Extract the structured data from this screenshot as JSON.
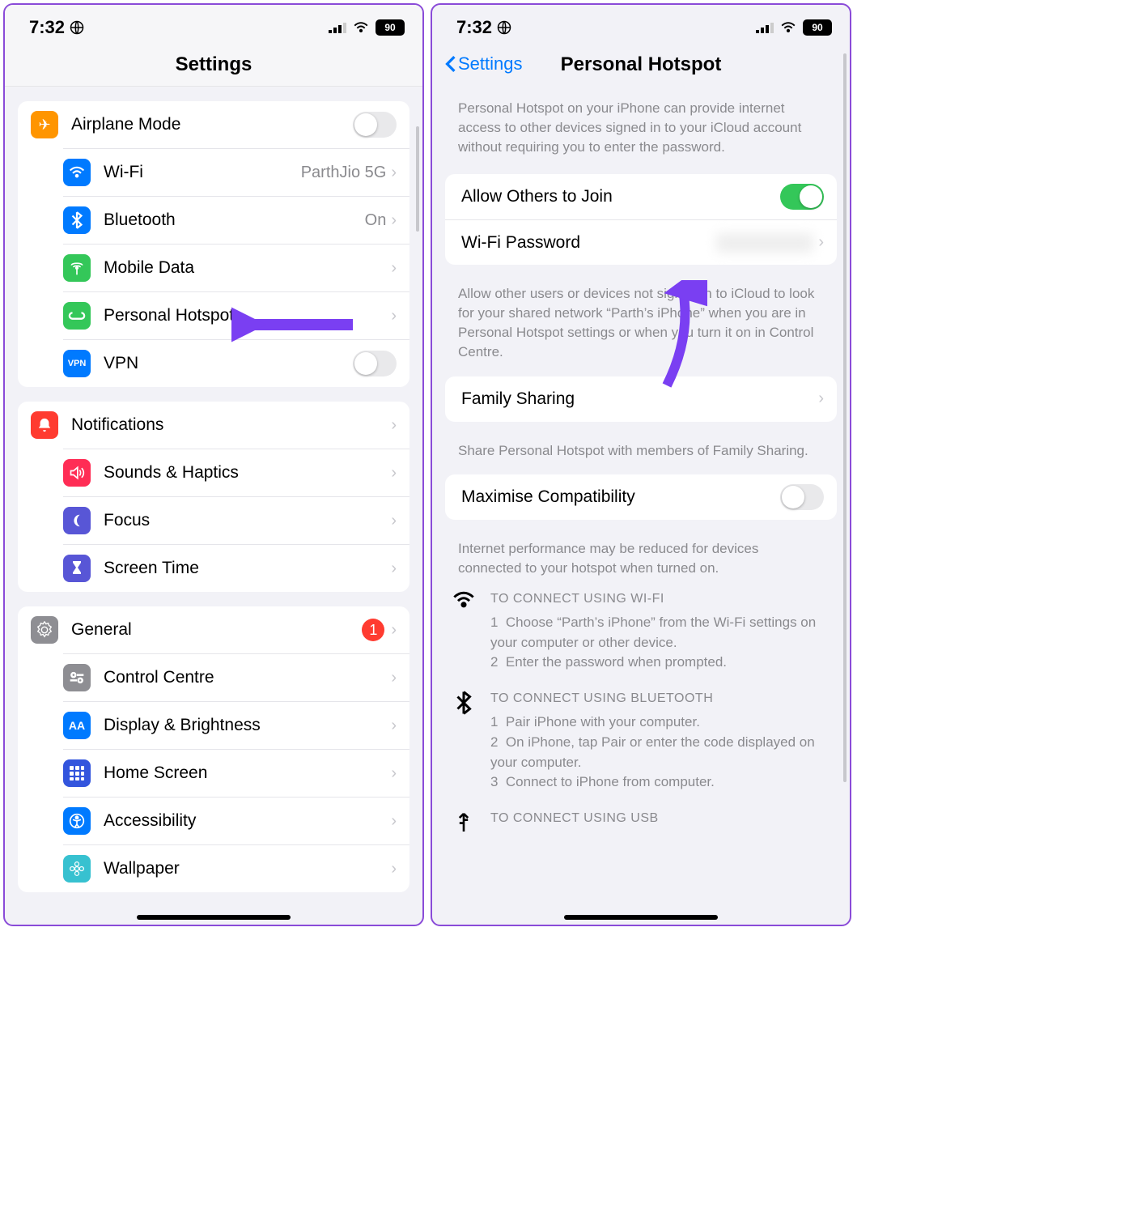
{
  "status": {
    "time": "7:32",
    "battery": "90"
  },
  "left": {
    "title": "Settings",
    "g1": [
      {
        "name": "airplane",
        "label": "Airplane Mode",
        "icon_bg": "#ff9500",
        "icon": "✈",
        "toggle": false
      },
      {
        "name": "wifi",
        "label": "Wi-Fi",
        "icon_bg": "#007aff",
        "icon": "wifi",
        "value": "ParthJio 5G",
        "chev": true
      },
      {
        "name": "bluetooth",
        "label": "Bluetooth",
        "icon_bg": "#007aff",
        "icon": "bt",
        "value": "On",
        "chev": true
      },
      {
        "name": "mobiledata",
        "label": "Mobile Data",
        "icon_bg": "#34c759",
        "icon": "ant",
        "chev": true
      },
      {
        "name": "hotspot",
        "label": "Personal Hotspot",
        "icon_bg": "#34c759",
        "icon": "link",
        "chev": true
      },
      {
        "name": "vpn",
        "label": "VPN",
        "icon_bg": "#007aff",
        "icon": "VPN",
        "toggle": false
      }
    ],
    "g2": [
      {
        "name": "notifications",
        "label": "Notifications",
        "icon_bg": "#ff3b30",
        "icon": "bell",
        "chev": true
      },
      {
        "name": "sounds",
        "label": "Sounds & Haptics",
        "icon_bg": "#ff2d55",
        "icon": "spk",
        "chev": true
      },
      {
        "name": "focus",
        "label": "Focus",
        "icon_bg": "#5856d6",
        "icon": "moon",
        "chev": true
      },
      {
        "name": "screentime",
        "label": "Screen Time",
        "icon_bg": "#5856d6",
        "icon": "hg",
        "chev": true
      }
    ],
    "g3": [
      {
        "name": "general",
        "label": "General",
        "icon_bg": "#8e8e93",
        "icon": "gear",
        "badge": "1",
        "chev": true
      },
      {
        "name": "controlcentre",
        "label": "Control Centre",
        "icon_bg": "#8e8e93",
        "icon": "cc",
        "chev": true
      },
      {
        "name": "display",
        "label": "Display & Brightness",
        "icon_bg": "#007aff",
        "icon": "AA",
        "chev": true
      },
      {
        "name": "homescreen",
        "label": "Home Screen",
        "icon_bg": "#3355dd",
        "icon": "grid",
        "chev": true
      },
      {
        "name": "accessibility",
        "label": "Accessibility",
        "icon_bg": "#007aff",
        "icon": "acc",
        "chev": true
      },
      {
        "name": "wallpaper",
        "label": "Wallpaper",
        "icon_bg": "#37c1d0",
        "icon": "flw",
        "chev": true
      }
    ]
  },
  "right": {
    "back": "Settings",
    "title": "Personal Hotspot",
    "intro": "Personal Hotspot on your iPhone can provide internet access to other devices signed in to your iCloud account without requiring you to enter the password.",
    "allow_label": "Allow Others to Join",
    "wifi_pw_label": "Wi-Fi Password",
    "allow_footer": "Allow other users or devices not signed in to iCloud to look for your shared network “Parth’s iPhone” when you are in Personal Hotspot settings or when you turn it on in Control Centre.",
    "family_label": "Family Sharing",
    "family_footer": "Share Personal Hotspot with members of Family Sharing.",
    "maxcompat_label": "Maximise Compatibility",
    "maxcompat_footer": "Internet performance may be reduced for devices connected to your hotspot when turned on.",
    "wifi_title": "TO CONNECT USING WI-FI",
    "wifi_1": "Choose “Parth’s iPhone” from the Wi-Fi settings on your computer or other device.",
    "wifi_2": "Enter the password when prompted.",
    "bt_title": "TO CONNECT USING BLUETOOTH",
    "bt_1": "Pair iPhone with your computer.",
    "bt_2": "On iPhone, tap Pair or enter the code displayed on your computer.",
    "bt_3": "Connect to iPhone from computer.",
    "usb_title": "TO CONNECT USING USB"
  }
}
